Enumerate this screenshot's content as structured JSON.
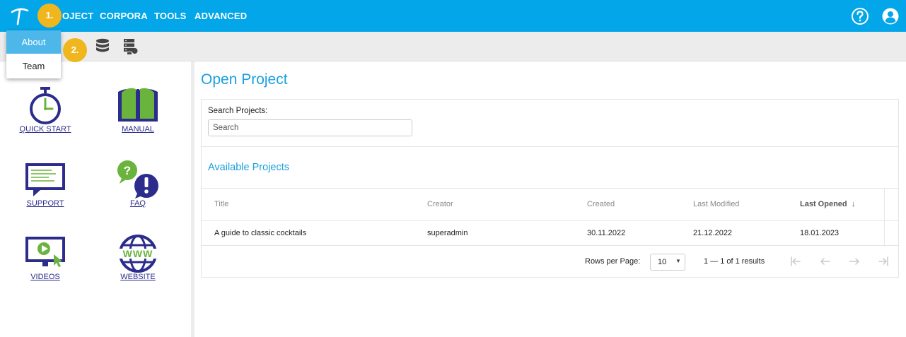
{
  "menu": {
    "items": [
      {
        "label": "OJECT"
      },
      {
        "label": "CORPORA"
      },
      {
        "label": "TOOLS"
      },
      {
        "label": "ADVANCED"
      }
    ]
  },
  "dropdown": {
    "items": [
      "About",
      "Team"
    ]
  },
  "badges": [
    "1.",
    "2."
  ],
  "left_panel": {
    "tiles": [
      {
        "label": "QUICK START",
        "icon": "stopwatch-icon"
      },
      {
        "label": "MANUAL",
        "icon": "book-icon"
      },
      {
        "label": "SUPPORT",
        "icon": "support-chat-icon"
      },
      {
        "label": "FAQ",
        "icon": "faq-bubbles-icon"
      },
      {
        "label": "VIDEOS",
        "icon": "video-monitor-icon"
      },
      {
        "label": "WEBSITE",
        "icon": "globe-www-icon"
      }
    ]
  },
  "main": {
    "title": "Open Project",
    "search_label": "Search Projects:",
    "search_placeholder": "Search",
    "available_title": "Available Projects",
    "columns": [
      "Title",
      "Creator",
      "Created",
      "Last Modified",
      "Last Opened"
    ],
    "sort_arrow": "↓",
    "rows": [
      [
        "A guide to classic cocktails",
        "superadmin",
        "30.11.2022",
        "21.12.2022",
        "18.01.2023"
      ]
    ],
    "rows_per_page_label": "Rows per Page:",
    "rows_per_page_value": "10",
    "range_text": "1 — 1 of 1 results"
  },
  "colors": {
    "brand": "#03a6e8",
    "accent_text": "#1aa0de",
    "badge": "#f0b61e",
    "icon_navy": "#2c2c8c",
    "icon_green": "#6ab43e"
  }
}
